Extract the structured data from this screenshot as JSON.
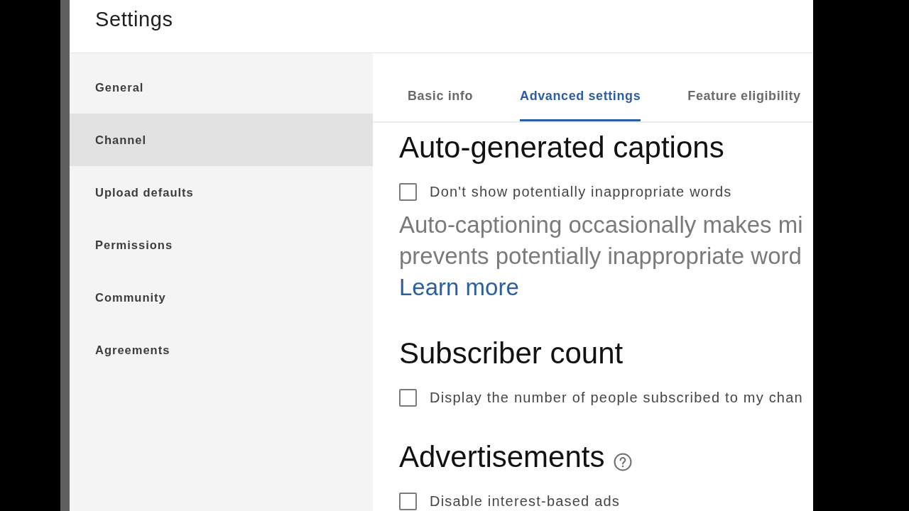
{
  "window": {
    "title": "Settings"
  },
  "sidebar": {
    "items": [
      {
        "label": "General",
        "selected": false
      },
      {
        "label": "Channel",
        "selected": true
      },
      {
        "label": "Upload defaults",
        "selected": false
      },
      {
        "label": "Permissions",
        "selected": false
      },
      {
        "label": "Community",
        "selected": false
      },
      {
        "label": "Agreements",
        "selected": false
      }
    ]
  },
  "tabs": [
    {
      "label": "Basic info",
      "selected": false
    },
    {
      "label": "Advanced settings",
      "selected": true
    },
    {
      "label": "Feature eligibility",
      "selected": false
    }
  ],
  "sections": [
    {
      "title": "Auto-generated captions",
      "options": [
        {
          "label": "Don't show potentially inappropriate words",
          "checked": false
        }
      ],
      "description_lines": [
        "Auto-captioning occasionally makes mi",
        "prevents potentially inappropriate word"
      ],
      "link": "Learn more"
    },
    {
      "title": "Subscriber count",
      "options": [
        {
          "label": "Display the number of people subscribed to my chan",
          "checked": false
        }
      ]
    },
    {
      "title": "Advertisements",
      "help": true,
      "options": [
        {
          "label": "Disable interest-based ads",
          "checked": false
        }
      ]
    }
  ]
}
